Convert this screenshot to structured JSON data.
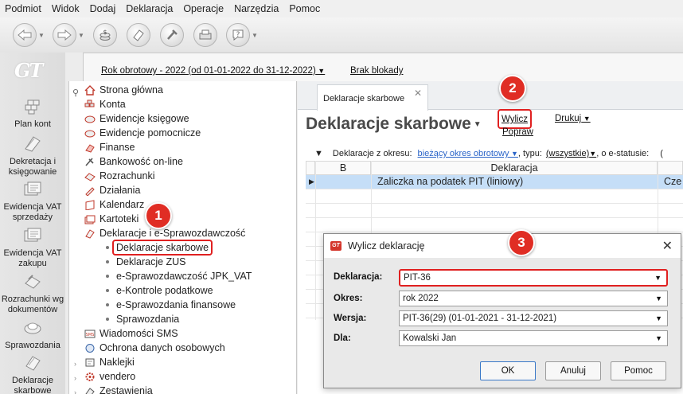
{
  "menu": [
    "Podmiot",
    "Widok",
    "Dodaj",
    "Deklaracja",
    "Operacje",
    "Narzędzia",
    "Pomoc"
  ],
  "toolbar": {
    "icons": [
      "back-icon",
      "forward-icon",
      "cash-icon",
      "document-icon",
      "tools-icon",
      "print-icon",
      "help-icon"
    ]
  },
  "logo": "GT",
  "leftnav": [
    {
      "label": "Plan kont"
    },
    {
      "label": "Dekretacja i księgowanie"
    },
    {
      "label": "Ewidencja VAT sprzedaży"
    },
    {
      "label": "Ewidencja VAT zakupu"
    },
    {
      "label": "Rozrachunki wg dokumentów"
    },
    {
      "label": "Sprawozdania"
    },
    {
      "label": "Deklaracje skarbowe"
    }
  ],
  "infobar": {
    "year": "Rok obrotowy - 2022  (od 01-01-2022 do 31-12-2022)",
    "lock": "Brak blokady"
  },
  "tree": {
    "items": [
      {
        "label": "Strona główna"
      },
      {
        "label": "Konta"
      },
      {
        "label": "Ewidencje księgowe"
      },
      {
        "label": "Ewidencje pomocnicze"
      },
      {
        "label": "Finanse"
      },
      {
        "label": "Bankowość on-line"
      },
      {
        "label": "Rozrachunki"
      },
      {
        "label": "Działania"
      },
      {
        "label": "Kalendarz"
      },
      {
        "label": "Kartoteki"
      },
      {
        "label": "Deklaracje i e-Sprawozdawczość"
      }
    ],
    "subitems": [
      {
        "label": "Deklaracje skarbowe"
      },
      {
        "label": "Deklaracje ZUS"
      },
      {
        "label": "e-Sprawozdawczość JPK_VAT"
      },
      {
        "label": "e-Kontrole podatkowe"
      },
      {
        "label": "e-Sprawozdania finansowe"
      },
      {
        "label": "Sprawozdania"
      }
    ],
    "after": [
      {
        "label": "Wiadomości SMS"
      },
      {
        "label": "Ochrona danych osobowych"
      },
      {
        "label": "Naklejki"
      },
      {
        "label": "vendero"
      },
      {
        "label": "Zestawienia"
      }
    ]
  },
  "main": {
    "tab": "Deklaracje skarbowe",
    "title": "Deklaracje skarbowe",
    "actions": {
      "wylicz": "Wylicz",
      "popraw": "Popraw",
      "drukuj": "Drukuj"
    },
    "filter": {
      "label": "Deklaracje z okresu:",
      "period": "bieżący okres obrotowy",
      "type_label": ", typu:",
      "type": "(wszystkie)",
      "status_label": ", o e-statusie:",
      "status_tail": "("
    },
    "grid": {
      "columns": [
        "B",
        "Deklaracja"
      ],
      "row": {
        "deklaracja": "Zaliczka na podatek PIT (liniowy)",
        "tail": "Cze"
      }
    }
  },
  "dialog": {
    "title": "Wylicz deklarację",
    "fields": [
      {
        "label": "Deklaracja:",
        "value": "PIT-36"
      },
      {
        "label": "Okres:",
        "value": "rok 2022"
      },
      {
        "label": "Wersja:",
        "value": "PIT-36(29) (01-01-2021 - 31-12-2021)"
      },
      {
        "label": "Dla:",
        "value": "Kowalski Jan"
      }
    ],
    "buttons": {
      "ok": "OK",
      "cancel": "Anuluj",
      "help": "Pomoc"
    }
  },
  "badges": [
    "1",
    "2",
    "3"
  ]
}
